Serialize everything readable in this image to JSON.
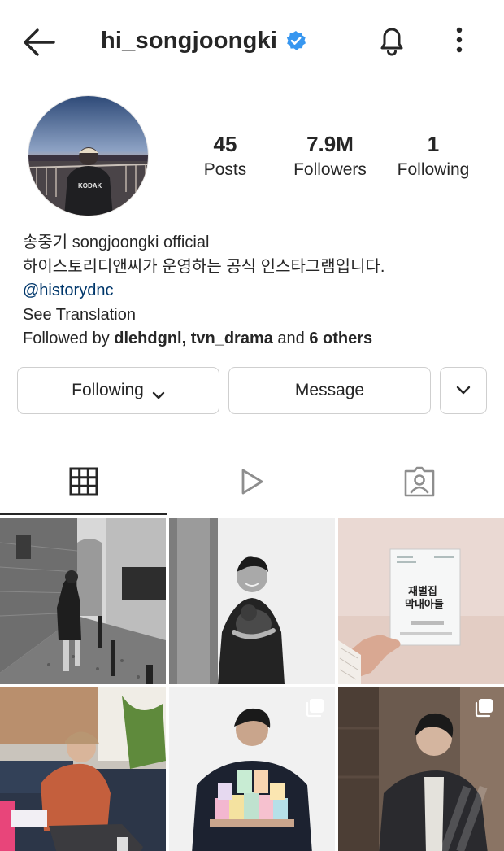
{
  "header": {
    "username": "hi_songjoongki",
    "icons": {
      "back": "back-arrow-icon",
      "verified": "verified-badge-icon",
      "notifications": "bell-icon",
      "more": "more-vertical-icon"
    },
    "verified_color": "#3897f0"
  },
  "stats": {
    "posts": {
      "value": "45",
      "label": "Posts"
    },
    "followers": {
      "value": "7.9M",
      "label": "Followers"
    },
    "following": {
      "value": "1",
      "label": "Following"
    }
  },
  "bio": {
    "name": "송중기 songjoongki official",
    "description": "하이스토리디앤씨가 운영하는 공식 인스타그램입니다.",
    "mention": "@historydnc",
    "see_translation": "See Translation",
    "followed_by_prefix": "Followed by ",
    "followed_by_users": "dlehdgnl, tvn_drama",
    "followed_by_and": " and ",
    "followed_by_others": "6 others"
  },
  "actions": {
    "following_label": "Following",
    "message_label": "Message"
  },
  "tabs": [
    {
      "name": "grid",
      "icon": "grid-icon",
      "active": true
    },
    {
      "name": "reels",
      "icon": "reels-play-icon",
      "active": false
    },
    {
      "name": "tagged",
      "icon": "tagged-user-icon",
      "active": false
    }
  ],
  "posts": [
    {
      "subject": "man-walking-cobblestone-street",
      "multi": false
    },
    {
      "subject": "man-holding-puppy-bw",
      "multi": false
    },
    {
      "subject": "script-book-in-hand",
      "multi": false,
      "book_title": "재벌집 막내아들"
    },
    {
      "subject": "man-sitting-on-sofa",
      "multi": false
    },
    {
      "subject": "man-holding-cups",
      "multi": true
    },
    {
      "subject": "man-in-suit",
      "multi": true
    }
  ],
  "colors": {
    "text": "#262626",
    "link": "#00376b",
    "border": "#cfcfcf"
  }
}
